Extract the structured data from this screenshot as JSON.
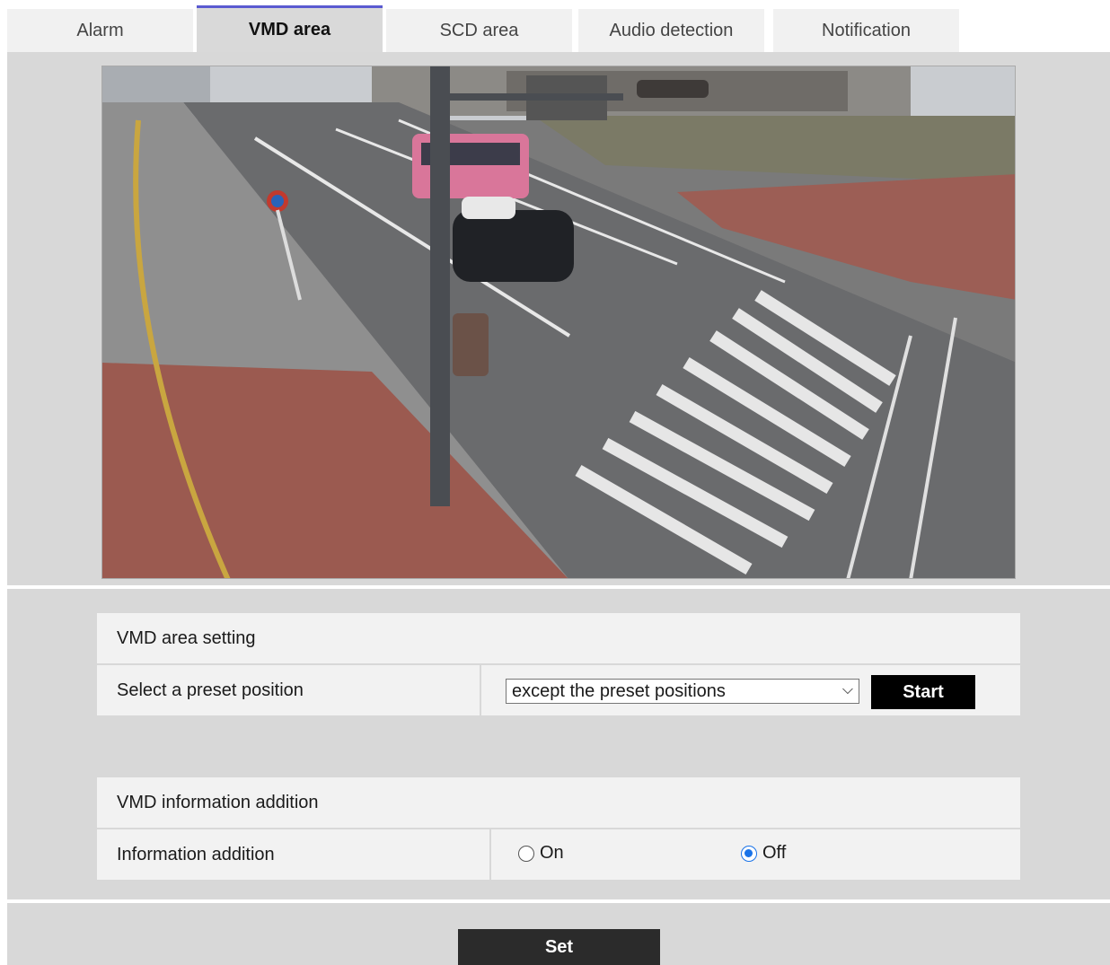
{
  "tabs": [
    {
      "label": "Alarm",
      "active": false
    },
    {
      "label": "VMD area",
      "active": true
    },
    {
      "label": "SCD area",
      "active": false
    },
    {
      "label": "Audio detection",
      "active": false
    },
    {
      "label": "Notification",
      "active": false
    }
  ],
  "camera": {
    "description_icon": "camera-live-image"
  },
  "vmd_area_setting": {
    "header": "VMD area setting",
    "preset_label": "Select a preset position",
    "preset_selected": "except the preset positions",
    "start_label": "Start"
  },
  "vmd_info": {
    "header": "VMD information addition",
    "label": "Information addition",
    "options": [
      {
        "label": "On",
        "checked": false
      },
      {
        "label": "Off",
        "checked": true
      }
    ]
  },
  "footer": {
    "set_label": "Set"
  },
  "colors": {
    "accent": "#5a5ad0",
    "radio": "#1a73e8",
    "panel": "#d8d8d8"
  }
}
